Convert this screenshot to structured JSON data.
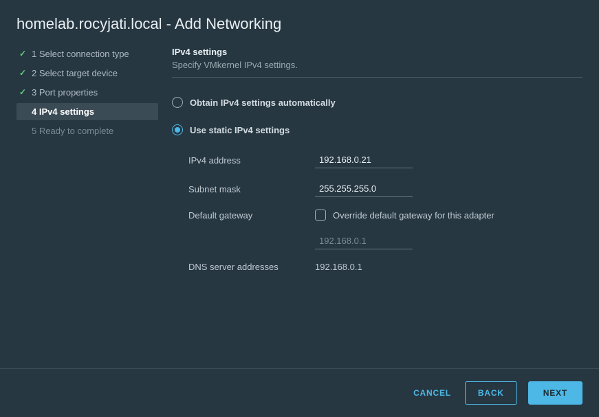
{
  "header": {
    "title": "homelab.rocyjati.local - Add Networking"
  },
  "sidebar": {
    "steps": [
      {
        "label": "1 Select connection type"
      },
      {
        "label": "2 Select target device"
      },
      {
        "label": "3 Port properties"
      },
      {
        "label": "4 IPv4 settings"
      },
      {
        "label": "5 Ready to complete"
      }
    ]
  },
  "main": {
    "section_title": "IPv4 settings",
    "section_subtitle": "Specify VMkernel IPv4 settings.",
    "radio_auto": "Obtain IPv4 settings automatically",
    "radio_static": "Use static IPv4 settings",
    "labels": {
      "ipv4_address": "IPv4 address",
      "subnet_mask": "Subnet mask",
      "default_gateway": "Default gateway",
      "dns": "DNS server addresses"
    },
    "values": {
      "ipv4_address": "192.168.0.21",
      "subnet_mask": "255.255.255.0",
      "gateway_placeholder": "192.168.0.1",
      "dns": "192.168.0.1"
    },
    "override_label": "Override default gateway for this adapter"
  },
  "footer": {
    "cancel": "CANCEL",
    "back": "BACK",
    "next": "NEXT"
  }
}
